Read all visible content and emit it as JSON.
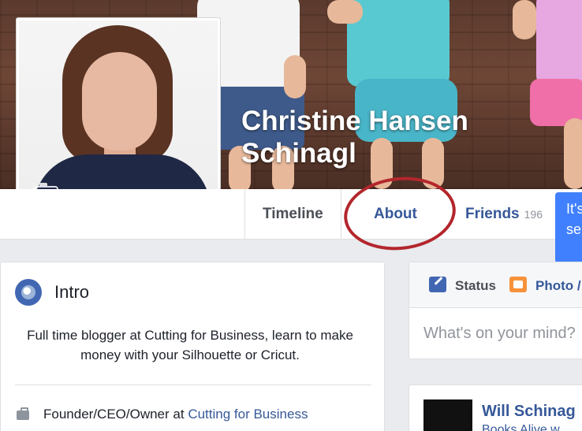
{
  "profile": {
    "name": "Christine Hansen Schinagl"
  },
  "nav": {
    "timeline": "Timeline",
    "about": "About",
    "friends": "Friends",
    "friends_count": "196"
  },
  "tooltip": {
    "text": "It's se m"
  },
  "intro": {
    "title": "Intro",
    "bio": "Full time blogger at Cutting for Business, learn to make money with your Silhouette or Cricut.",
    "work_prefix": "Founder/CEO/Owner at ",
    "work_link": "Cutting for Business"
  },
  "composer": {
    "status_label": "Status",
    "photo_label": "Photo /",
    "placeholder": "What's on your mind?"
  },
  "post": {
    "author": "Will Schinag",
    "subtitle": "Books Alive w"
  },
  "colors": {
    "link_blue": "#365899",
    "accent_blue": "#4267b2",
    "annotation_red": "#b3262c",
    "background": "#e9ebee"
  }
}
